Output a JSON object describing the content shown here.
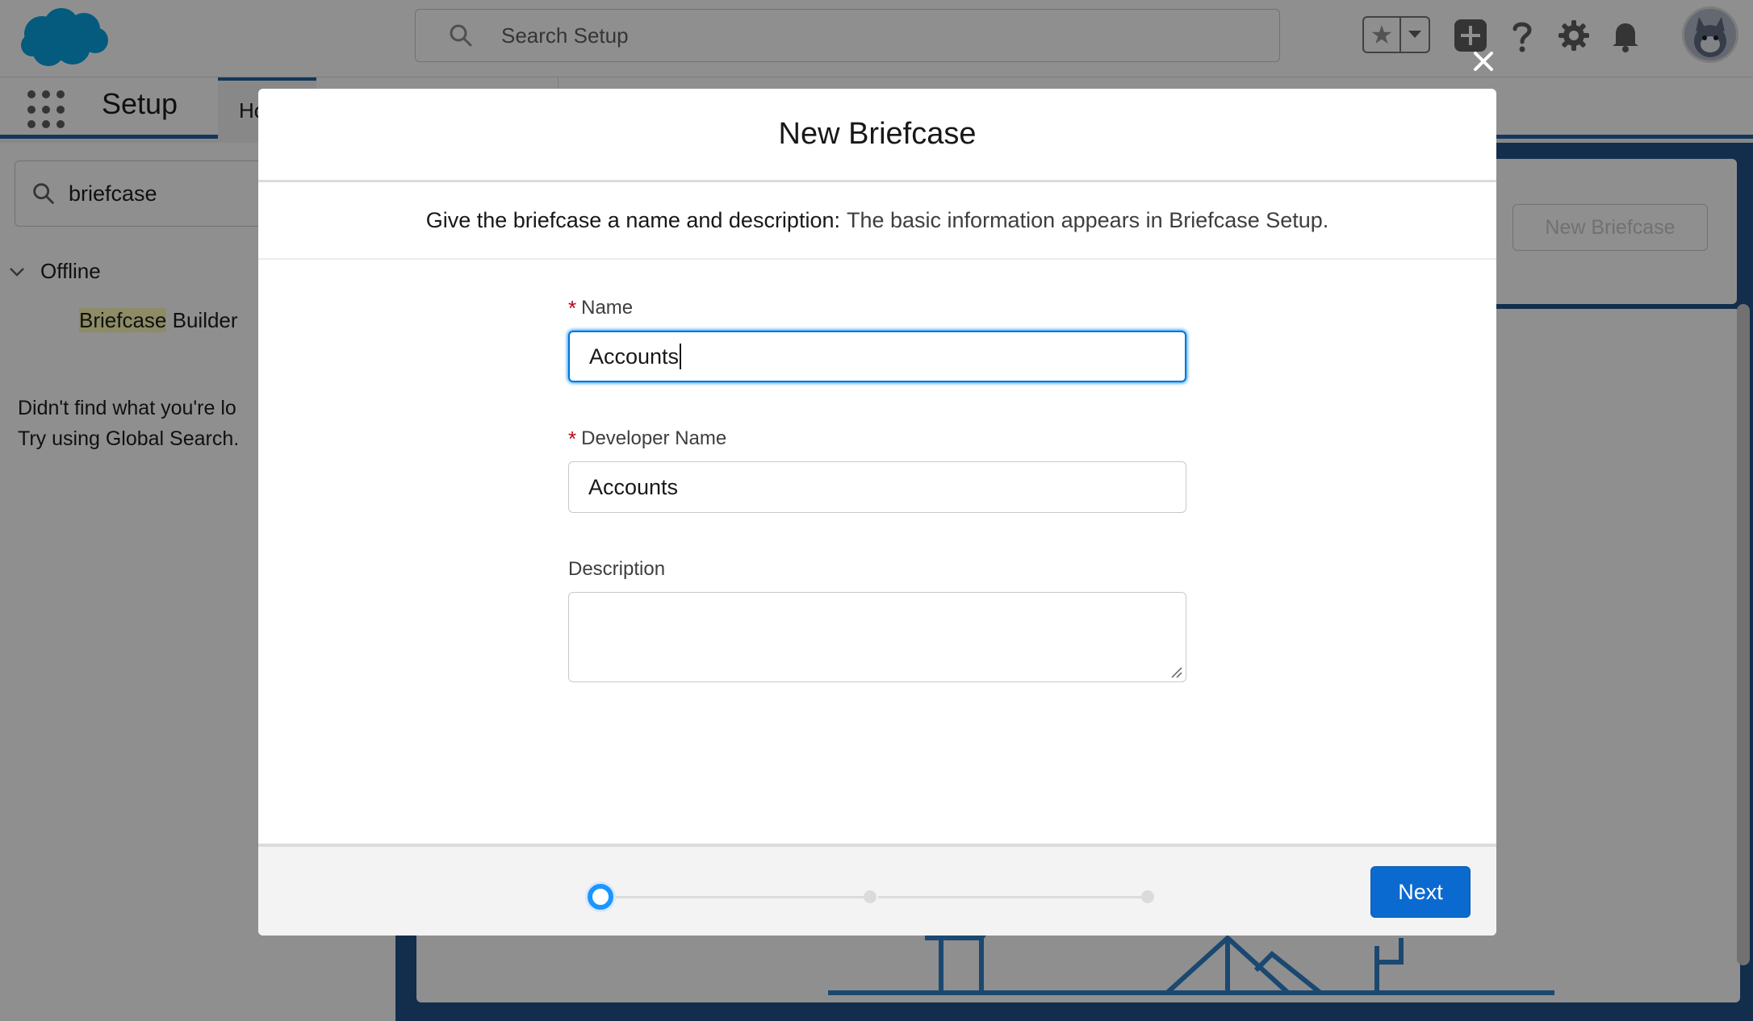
{
  "header": {
    "search_placeholder": "Search Setup",
    "icons": [
      "salesforce-logo",
      "search-icon",
      "star-icon",
      "chevron-down-icon",
      "add-icon",
      "help-icon",
      "gear-icon",
      "bell-icon",
      "avatar"
    ]
  },
  "app_nav": {
    "app_name": "Setup",
    "tab_label": "Ho"
  },
  "left_panel": {
    "quick_find_value": "briefcase",
    "tree_node": "Offline",
    "tree_leaf_highlight": "Briefcase",
    "tree_leaf_rest": " Builder",
    "not_found_line1": "Didn't find what you're lo",
    "not_found_line2": "Try using Global Search."
  },
  "background": {
    "new_briefcase_button": "New Briefcase"
  },
  "modal": {
    "title": "New Briefcase",
    "subtitle_lead": "Give the briefcase a name and description:",
    "subtitle_rest": "The basic information appears in Briefcase Setup.",
    "fields": {
      "name_label": "Name",
      "name_value": "Accounts",
      "dev_name_label": "Developer Name",
      "dev_name_value": "Accounts",
      "description_label": "Description",
      "description_value": ""
    },
    "required_marker": "*",
    "progress": {
      "current_step": 1,
      "total_steps": 3
    },
    "next_button": "Next"
  },
  "colors": {
    "brand_blue": "#0b6ad0",
    "focus_ring": "#1b96ff",
    "required_red": "#ba0517",
    "salesforce_cloud": "#00a1e0"
  }
}
